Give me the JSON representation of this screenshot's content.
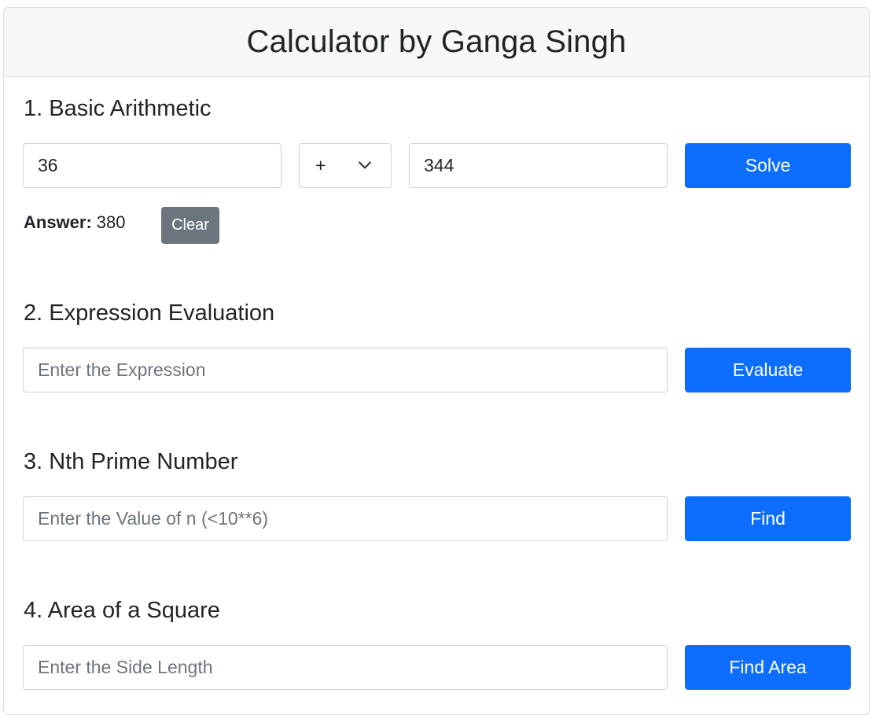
{
  "header": {
    "title": "Calculator by Ganga Singh"
  },
  "basic": {
    "title": "1. Basic Arithmetic",
    "operand1": "36",
    "operator": "+",
    "operand2": "344",
    "solve_label": "Solve",
    "answer_label": "Answer:",
    "answer_value": "380",
    "clear_label": "Clear"
  },
  "expression": {
    "title": "2. Expression Evaluation",
    "placeholder": "Enter the Expression",
    "button_label": "Evaluate"
  },
  "prime": {
    "title": "3. Nth Prime Number",
    "placeholder": "Enter the Value of n (<10**6)",
    "button_label": "Find"
  },
  "square": {
    "title": "4. Area of a Square",
    "placeholder": "Enter the Side Length",
    "button_label": "Find Area"
  },
  "colors": {
    "primary": "#0d6efd",
    "secondary": "#6c757d",
    "header_bg": "#f7f7f7"
  },
  "icons": {
    "operator_dropdown": "chevron-down-icon"
  }
}
